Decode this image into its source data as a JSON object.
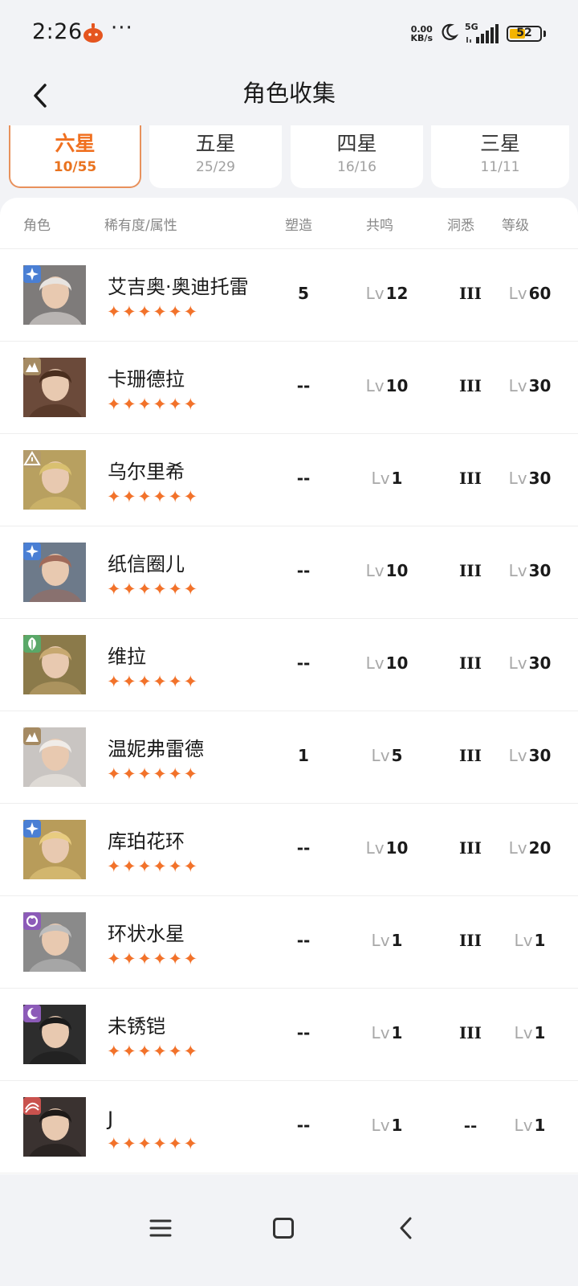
{
  "status_bar": {
    "time": "2:26",
    "dots": "···",
    "net_speed_value": "0.00",
    "net_speed_unit": "KB/s",
    "network": "5G",
    "battery": "52"
  },
  "header": {
    "title": "角色收集"
  },
  "tabs": [
    {
      "label": "六星",
      "count": "10/55",
      "active": true
    },
    {
      "label": "五星",
      "count": "25/29",
      "active": false
    },
    {
      "label": "四星",
      "count": "16/16",
      "active": false
    },
    {
      "label": "三星",
      "count": "11/11",
      "active": false
    }
  ],
  "columns": {
    "character": "角色",
    "rarity_attr": "稀有度/属性",
    "forge": "塑造",
    "resonance": "共鸣",
    "insight": "洞悉",
    "level": "等级"
  },
  "lv_prefix": "Lv",
  "stars": "✦✦✦✦✦✦",
  "attribute_colors": {
    "blue": "#4a7fd4",
    "brown": "#a58a62",
    "olive": "#b39b6c",
    "green": "#5aa868",
    "purple": "#8c5bb8",
    "red": "#c9524e"
  },
  "accent_color": "#f07020",
  "characters": [
    {
      "name": "艾吉奥·奥迪托雷",
      "forge": "5",
      "resonance": "12",
      "insight": "III",
      "level": "60",
      "attribute_icon": "star-cross-icon",
      "attribute_color": "blue"
    },
    {
      "name": "卡珊德拉",
      "forge": "--",
      "resonance": "10",
      "insight": "III",
      "level": "30",
      "attribute_icon": "mountain-icon",
      "attribute_color": "brown"
    },
    {
      "name": "乌尔里希",
      "forge": "--",
      "resonance": "1",
      "insight": "III",
      "level": "30",
      "attribute_icon": "triangle-icon",
      "attribute_color": "olive"
    },
    {
      "name": "纸信圈儿",
      "forge": "--",
      "resonance": "10",
      "insight": "III",
      "level": "30",
      "attribute_icon": "star-cross-icon",
      "attribute_color": "blue"
    },
    {
      "name": "维拉",
      "forge": "--",
      "resonance": "10",
      "insight": "III",
      "level": "30",
      "attribute_icon": "leaf-icon",
      "attribute_color": "green"
    },
    {
      "name": "温妮弗雷德",
      "forge": "1",
      "resonance": "5",
      "insight": "III",
      "level": "30",
      "attribute_icon": "mountain-icon",
      "attribute_color": "brown"
    },
    {
      "name": "库珀花环",
      "forge": "--",
      "resonance": "10",
      "insight": "III",
      "level": "20",
      "attribute_icon": "star-cross-icon",
      "attribute_color": "blue"
    },
    {
      "name": "环状水星",
      "forge": "--",
      "resonance": "1",
      "insight": "III",
      "level": "1",
      "attribute_icon": "ring-icon",
      "attribute_color": "purple"
    },
    {
      "name": "未锈铠",
      "forge": "--",
      "resonance": "1",
      "insight": "III",
      "level": "1",
      "attribute_icon": "moon-icon",
      "attribute_color": "purple"
    },
    {
      "name": "J",
      "forge": "--",
      "resonance": "1",
      "insight": "--",
      "level": "1",
      "attribute_icon": "wave-icon",
      "attribute_color": "red"
    }
  ]
}
